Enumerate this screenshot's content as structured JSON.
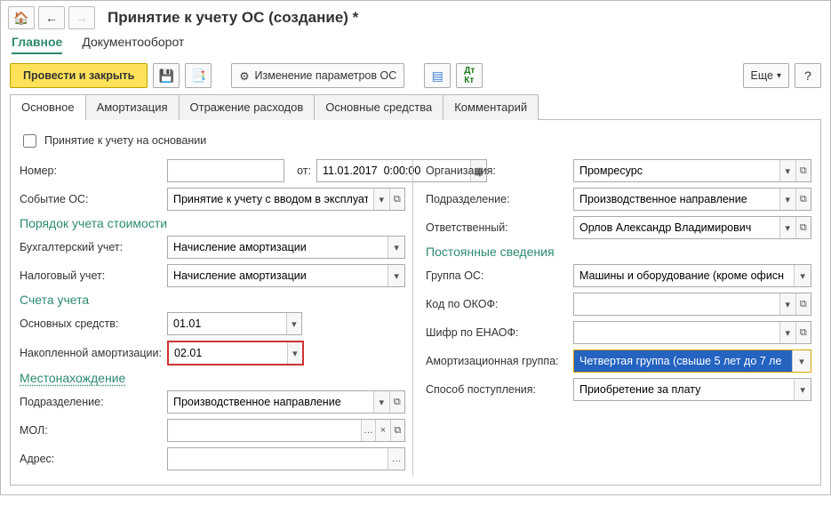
{
  "header": {
    "title": "Принятие к учету ОС (создание) *",
    "tabs": [
      "Главное",
      "Документооборот"
    ]
  },
  "toolbar": {
    "post_close": "Провести и закрыть",
    "change_params": "Изменение параметров ОС",
    "more": "Еще",
    "help": "?"
  },
  "tabs": [
    "Основное",
    "Амортизация",
    "Отражение расходов",
    "Основные средства",
    "Комментарий"
  ],
  "main": {
    "cb_based_on": "Принятие к учету на основании",
    "labels": {
      "number": "Номер:",
      "from": "от:",
      "event": "Событие ОС:",
      "order_section": "Порядок учета стоимости",
      "acc_record": "Бухгалтерский учет:",
      "tax_record": "Налоговый учет:",
      "accounts_section": "Счета учета",
      "acc_fixed": "Основных средств:",
      "acc_deprec": "Накопленной амортизации:",
      "location_section": "Местонахождение",
      "department": "Подразделение:",
      "mol": "МОЛ:",
      "address": "Адрес:"
    },
    "values": {
      "number": "",
      "date": "11.01.2017  0:00:00",
      "event": "Принятие к учету с вводом в эксплуатац",
      "acc_record": "Начисление амортизации",
      "tax_record": "Начисление амортизации",
      "acc_fixed": "01.01",
      "acc_deprec": "02.01",
      "department": "Производственное направление",
      "mol": "",
      "address": ""
    }
  },
  "right": {
    "labels": {
      "org": "Организация:",
      "dept": "Подразделение:",
      "resp": "Ответственный:",
      "const_section": "Постоянные сведения",
      "group": "Группа ОС:",
      "okof": "Код по ОКОФ:",
      "enaof": "Шифр по ЕНАОФ:",
      "amort_group": "Амортизационная группа:",
      "receipt": "Способ поступления:"
    },
    "values": {
      "org": "Промресурс",
      "dept": "Производственное направление",
      "resp": "Орлов Александр Владимирович",
      "group": "Машины и оборудование (кроме офисн",
      "okof": "",
      "enaof": "",
      "amort_group": "Четвертая группа (свыше 5 лет до 7 ле",
      "receipt": "Приобретение за плату"
    }
  }
}
